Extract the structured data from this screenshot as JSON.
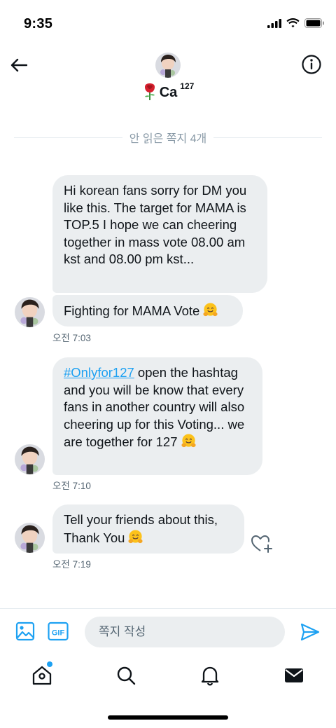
{
  "status_bar": {
    "time": "9:35"
  },
  "header": {
    "name": "Ca",
    "name_superscript": "127",
    "name_emoji": "rose"
  },
  "conversation": {
    "unread_divider": "안 읽은 쪽지 4개",
    "messages": [
      {
        "text": "Hi korean fans sorry for DM you like this. The target for MAMA is TOP.5  I hope we can cheering together in mass vote 08.00 am kst and 08.00 pm kst..."
      },
      {
        "text": "Fighting for MAMA Vote",
        "emoji": "hugging-face",
        "timestamp": "오전 7:03"
      },
      {
        "hashtag": "#Onlyfor127",
        "text": " open the hashtag and you will be know that every fans in another country will also cheering up for this Voting... we are together for 127",
        "emoji": "hugging-face",
        "timestamp": "오전 7:10"
      },
      {
        "text": "Tell your friends about this, Thank You",
        "emoji": "hugging-face",
        "timestamp": "오전 7:19"
      }
    ]
  },
  "composer": {
    "placeholder": "쪽지 작성",
    "value": "",
    "gif_label": "GIF"
  },
  "colors": {
    "accent": "#1da1f2",
    "bubble": "#ebeef0",
    "muted_text": "#536471",
    "divider_text": "#8899a6"
  },
  "tabs": [
    {
      "name": "home",
      "icon": "home-icon",
      "has_notification_dot": true
    },
    {
      "name": "search",
      "icon": "search-icon"
    },
    {
      "name": "notifications",
      "icon": "bell-icon"
    },
    {
      "name": "messages",
      "icon": "envelope-icon",
      "active": true
    }
  ]
}
